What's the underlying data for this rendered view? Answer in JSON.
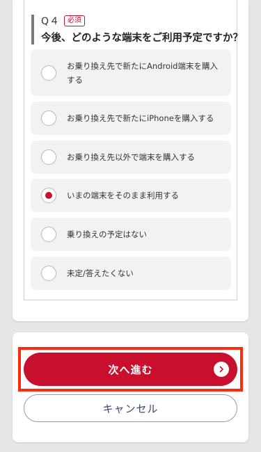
{
  "question": {
    "number": "Q４",
    "required_label": "必須",
    "text": "今後、どのような端末をご利用予定ですか？"
  },
  "options": [
    {
      "label": "お乗り換え先で新たにAndroid端末を購入する",
      "checked": false
    },
    {
      "label": "お乗り換え先で新たにiPhoneを購入する",
      "checked": false
    },
    {
      "label": "お乗り換え先以外で端末を購入する",
      "checked": false
    },
    {
      "label": "いまの端末をそのまま利用する",
      "checked": true
    },
    {
      "label": "乗り換えの予定はない",
      "checked": false
    },
    {
      "label": "未定/答えたくない",
      "checked": false
    }
  ],
  "actions": {
    "next_label": "次へ進む",
    "cancel_label": "キャンセル"
  },
  "colors": {
    "accent": "#c8102e",
    "highlight": "#ff2a10",
    "option_bg": "#f2f2f4"
  },
  "icons": {
    "next": "chevron-right-icon"
  }
}
